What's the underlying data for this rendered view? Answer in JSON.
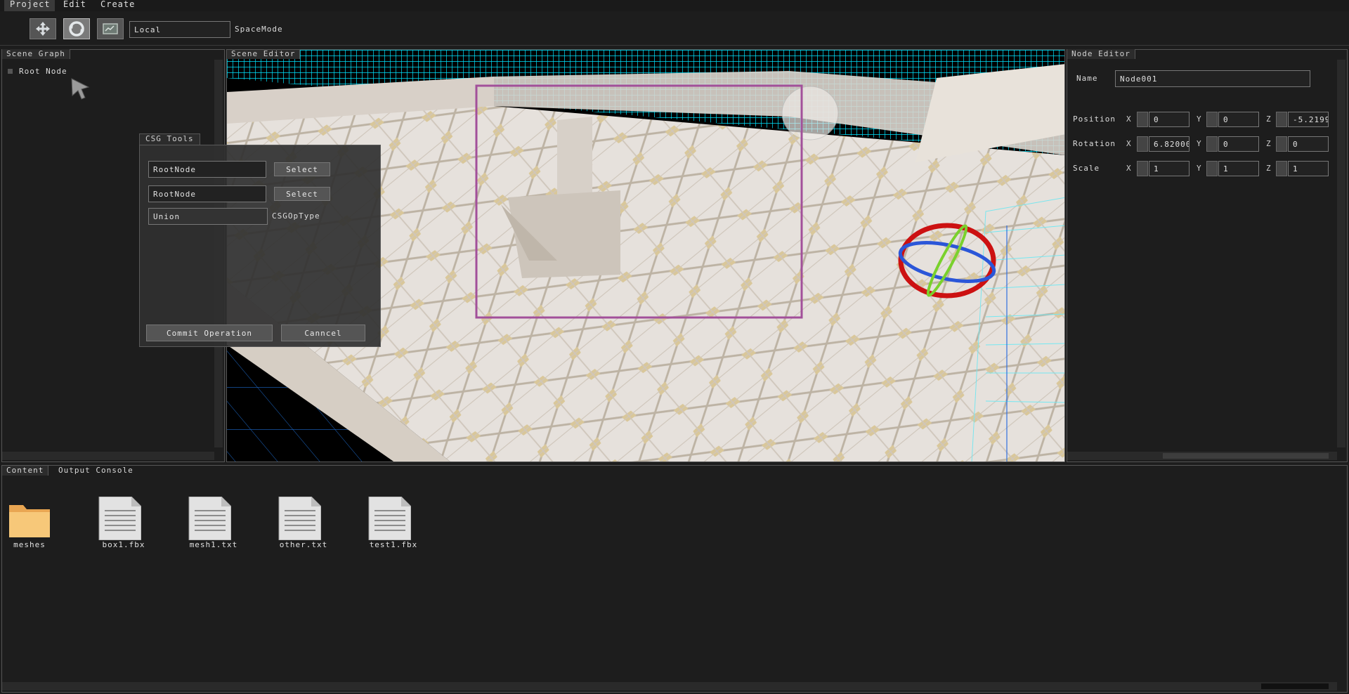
{
  "menu": {
    "items": [
      {
        "label": "Project"
      },
      {
        "label": "Edit"
      },
      {
        "label": "Create"
      }
    ]
  },
  "toolbar": {
    "space_value": "Local",
    "space_label": "SpaceMode",
    "tools": [
      {
        "icon": "move-arrows-icon"
      },
      {
        "icon": "rotate-arrows-icon"
      },
      {
        "icon": "scale-box-icon"
      }
    ]
  },
  "scene_graph": {
    "title": "Scene Graph",
    "root_label": "Root Node"
  },
  "csg_tools": {
    "title": "CSG Tools",
    "operand_a": "RootNode",
    "operand_b": "RootNode",
    "select_label": "Select",
    "op_type_value": "Union",
    "op_type_label": "CSGOpType",
    "commit_label": "Commit Operation",
    "cancel_label": "Canncel"
  },
  "scene_editor": {
    "title": "Scene Editor"
  },
  "node_editor": {
    "title": "Node Editor",
    "name_label": "Name",
    "name_value": "Node001",
    "rows": [
      {
        "label": "Position",
        "x": "0",
        "y": "0",
        "z": "-5.2199"
      },
      {
        "label": "Rotation",
        "x": "6.82000",
        "y": "0",
        "z": "0"
      },
      {
        "label": "Scale",
        "x": "1",
        "y": "1",
        "z": "1"
      }
    ],
    "axis_x": "X",
    "axis_y": "Y",
    "axis_z": "Z"
  },
  "bottom_tabs": [
    {
      "label": "Content"
    },
    {
      "label": "Output Console"
    }
  ],
  "content_items": [
    {
      "name": "meshes",
      "icon": "folder-icon"
    },
    {
      "name": "box1.fbx",
      "icon": "document-icon"
    },
    {
      "name": "mesh1.txt",
      "icon": "document-icon"
    },
    {
      "name": "other.txt",
      "icon": "document-icon"
    },
    {
      "name": "test1.fbx",
      "icon": "document-icon"
    }
  ],
  "colors": {
    "selection": "#a2509a",
    "gizmo_red": "#cc1111",
    "gizmo_blue": "#2b56d8",
    "gizmo_green": "#7ad12c",
    "grid": "#00e5ff"
  }
}
